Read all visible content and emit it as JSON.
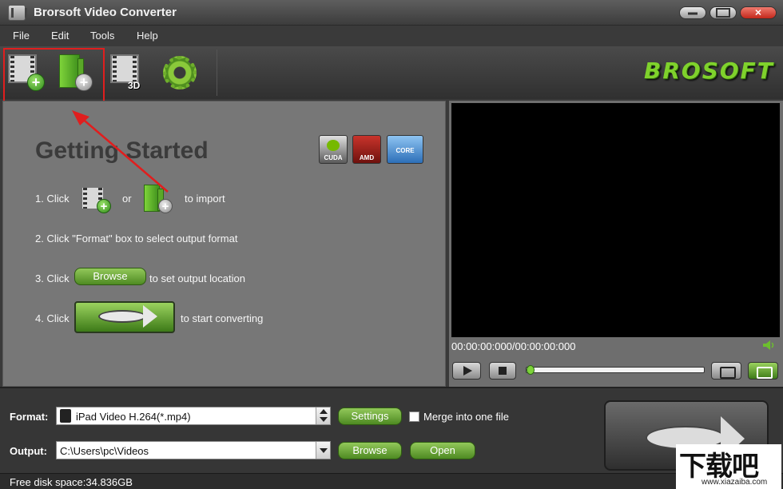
{
  "window": {
    "title": "Brorsoft Video Converter"
  },
  "menu": {
    "items": [
      "File",
      "Edit",
      "Tools",
      "Help"
    ]
  },
  "toolbar": {
    "buttons": [
      {
        "icon": "add-video-icon"
      },
      {
        "icon": "add-folder-icon"
      },
      {
        "icon": "edit-3d-icon",
        "badge": "3D"
      },
      {
        "icon": "gear-icon"
      }
    ],
    "logo_text": "BROSOFT"
  },
  "getting_started": {
    "title": "Getting Started",
    "badges": [
      "CUDA",
      "AMD",
      "CORE"
    ],
    "steps": {
      "s1_prefix": "1. Click",
      "s1_or": "or",
      "s1_suffix": "to import",
      "s2": "2. Click \"Format\" box to select output format",
      "s3_prefix": "3. Click",
      "s3_button": "Browse",
      "s3_suffix": "to set output location",
      "s4_prefix": "4. Click",
      "s4_suffix": "to start converting"
    }
  },
  "player": {
    "timecode": "00:00:00:000/00:00:00:000",
    "progress": 0
  },
  "bottom": {
    "format_label": "Format:",
    "format_value": "iPad Video H.264(*.mp4)",
    "settings_label": "Settings",
    "merge_label": "Merge into one file",
    "merge_checked": false,
    "output_label": "Output:",
    "output_value": "C:\\Users\\pc\\Videos",
    "browse_label": "Browse",
    "open_label": "Open"
  },
  "status": {
    "free_space": "Free disk space:34.836GB"
  },
  "watermark": {
    "main": "下载吧",
    "sub": "www.xiazaiba.com"
  },
  "colors": {
    "accent_green": "#6cbf2e",
    "highlight_red": "#e01e1e"
  }
}
